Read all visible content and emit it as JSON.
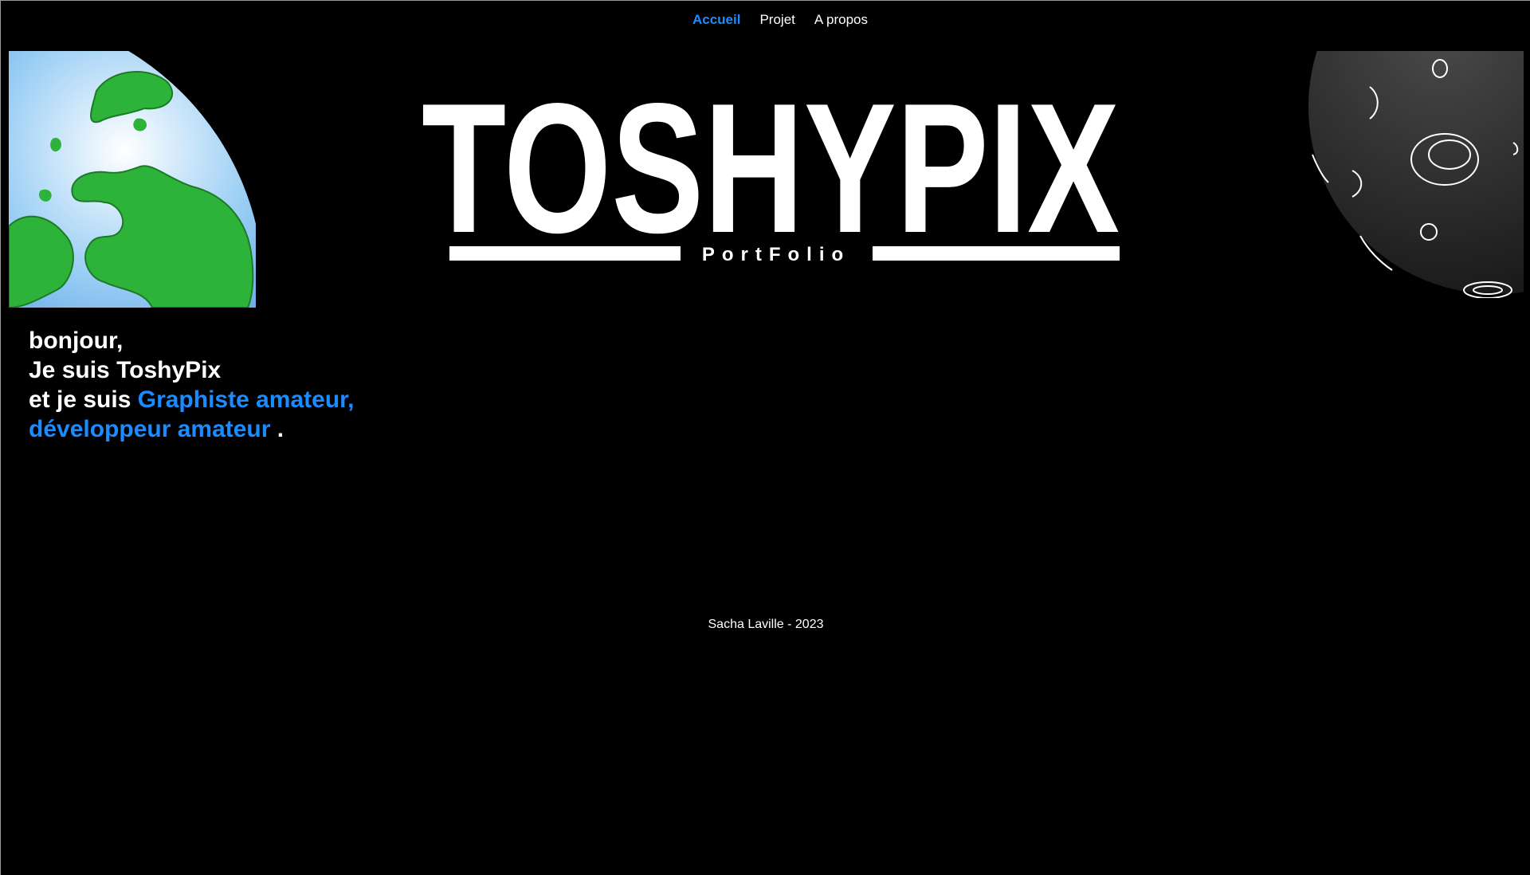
{
  "nav": {
    "items": [
      {
        "label": "Accueil",
        "active": true
      },
      {
        "label": "Projet",
        "active": false
      },
      {
        "label": "A propos",
        "active": false
      }
    ]
  },
  "logo": {
    "title": "TOSHYPIX",
    "subtitle": "PortFolio"
  },
  "intro": {
    "line1": "bonjour,",
    "line2": "Je suis ToshyPix",
    "line3_prefix": "et je suis ",
    "line3_accent": "Graphiste amateur,",
    "line4_accent": "développeur amateur",
    "line4_suffix": " ."
  },
  "footer": {
    "text": "Sacha Laville - 2023"
  },
  "colors": {
    "background": "#000000",
    "accent": "#1a8cff",
    "text": "#ffffff",
    "earth_land": "#2db23a",
    "earth_ocean": "#1a73c9",
    "moon": "#2b2b2b"
  },
  "icons": {
    "earth": "earth-illustration",
    "moon": "moon-illustration"
  }
}
